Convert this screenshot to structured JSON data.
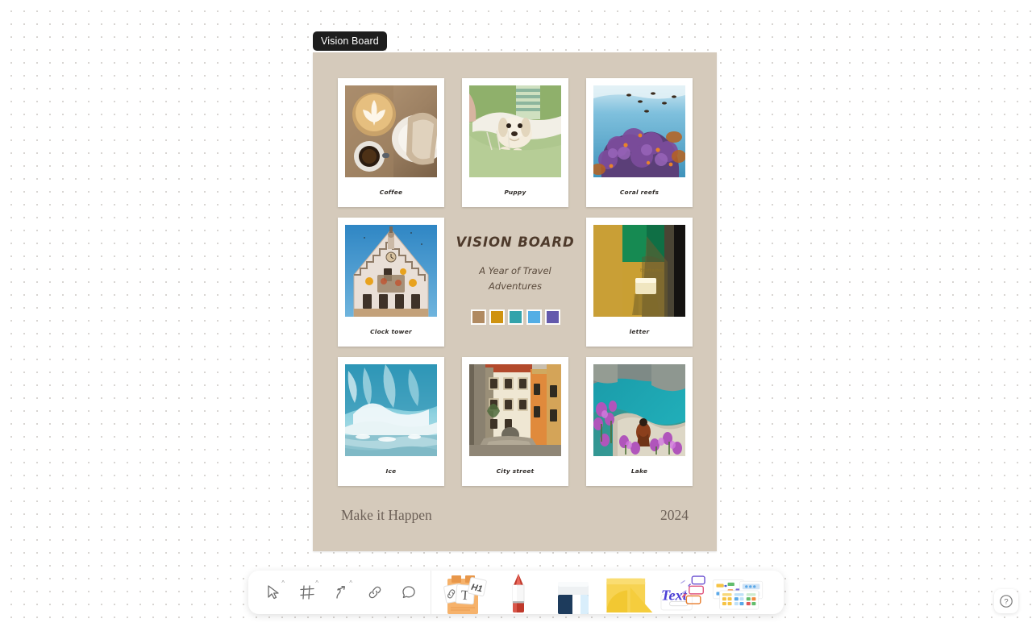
{
  "canvas": {
    "background_color": "#ffffff",
    "dot_color": "#d8d5d2"
  },
  "board": {
    "title_chip": "Vision Board",
    "background_color": "#d5cabb",
    "center_panel": {
      "title": "VISION BOARD",
      "subtitle": "A Year of Travel Adventures",
      "swatches": [
        {
          "name": "swatch-tan",
          "color": "#b08a61"
        },
        {
          "name": "swatch-gold",
          "color": "#cf9310"
        },
        {
          "name": "swatch-teal",
          "color": "#33a3ab"
        },
        {
          "name": "swatch-sky",
          "color": "#53aee5"
        },
        {
          "name": "swatch-purple",
          "color": "#6359ac"
        }
      ]
    },
    "cards": [
      {
        "caption": "Coffee",
        "name": "card-coffee"
      },
      {
        "caption": "Puppy",
        "name": "card-puppy"
      },
      {
        "caption": "Coral reefs",
        "name": "card-coral-reefs"
      },
      {
        "caption": "Clock tower",
        "name": "card-clock-tower"
      },
      {
        "caption": "letter",
        "name": "card-letter"
      },
      {
        "caption": "Ice",
        "name": "card-ice"
      },
      {
        "caption": "City street",
        "name": "card-city-street"
      },
      {
        "caption": "Lake",
        "name": "card-lake"
      }
    ],
    "footer": {
      "motto": "Make it Happen",
      "year": "2024"
    }
  },
  "toolbar": {
    "tools": [
      {
        "name": "select-tool",
        "icon": "cursor-icon",
        "has_caret": true
      },
      {
        "name": "frame-tool",
        "icon": "frame-icon",
        "has_caret": true
      },
      {
        "name": "draw-tool",
        "icon": "pen-arrow-icon",
        "has_caret": true
      },
      {
        "name": "link-tool",
        "icon": "link-icon",
        "has_caret": false
      },
      {
        "name": "comment-tool",
        "icon": "comment-icon",
        "has_caret": false
      }
    ],
    "big_tools": [
      {
        "name": "text-card-tool",
        "icon": "text-cards-icon",
        "label": "T"
      },
      {
        "name": "pen-marker-tool",
        "icon": "marker-icon"
      },
      {
        "name": "eraser-tool",
        "icon": "eraser-icon"
      },
      {
        "name": "sticky-note-tool",
        "icon": "sticky-note-icon"
      },
      {
        "name": "text-shapes-tool",
        "icon": "text-shapes-icon",
        "label": "Text"
      },
      {
        "name": "templates-tool",
        "icon": "templates-icon"
      }
    ]
  },
  "help": {
    "label": "?"
  }
}
